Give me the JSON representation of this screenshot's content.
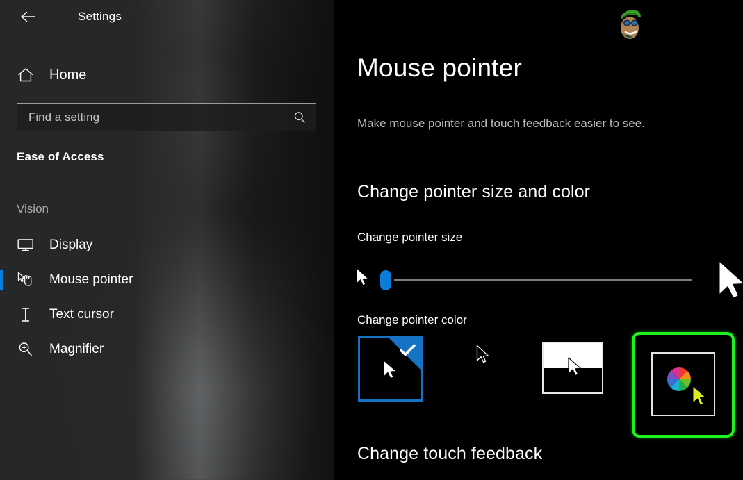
{
  "window": {
    "app_title": "Settings",
    "back_icon": "back-arrow-icon"
  },
  "sidebar": {
    "home": {
      "label": "Home",
      "icon": "home-icon"
    },
    "search": {
      "placeholder": "Find a setting",
      "value": "",
      "icon": "search-icon"
    },
    "section_title": "Ease of Access",
    "group_label": "Vision",
    "items": [
      {
        "label": "Display",
        "icon": "monitor-icon",
        "selected": false
      },
      {
        "label": "Mouse pointer",
        "icon": "hand-pointer-icon",
        "selected": true
      },
      {
        "label": "Text cursor",
        "icon": "text-cursor-icon",
        "selected": false
      },
      {
        "label": "Magnifier",
        "icon": "magnifier-icon",
        "selected": false
      }
    ],
    "accent_color": "#0a7ddb"
  },
  "main": {
    "page_title": "Mouse pointer",
    "page_subtitle": "Make mouse pointer and touch feedback easier to see.",
    "avatar": "user-avatar",
    "sections": {
      "size_and_color": {
        "heading": "Change pointer size and color",
        "size_label": "Change pointer size",
        "slider": {
          "value": 1,
          "min": 1,
          "max": 15,
          "thumb_color": "#0a7ddb",
          "track_color": "#7b7c7d"
        },
        "color_label": "Change pointer color",
        "options": [
          {
            "name": "white-pointer",
            "selected": true,
            "check_icon": "check-icon",
            "border_color": "#1672c4"
          },
          {
            "name": "black-pointer",
            "selected": false
          },
          {
            "name": "inverted-pointer",
            "selected": false
          },
          {
            "name": "custom-color-pointer",
            "selected": false,
            "highlight_color": "#1ff01f",
            "wheel_icon": "color-wheel-icon"
          }
        ]
      },
      "touch_feedback": {
        "heading": "Change touch feedback"
      }
    }
  }
}
